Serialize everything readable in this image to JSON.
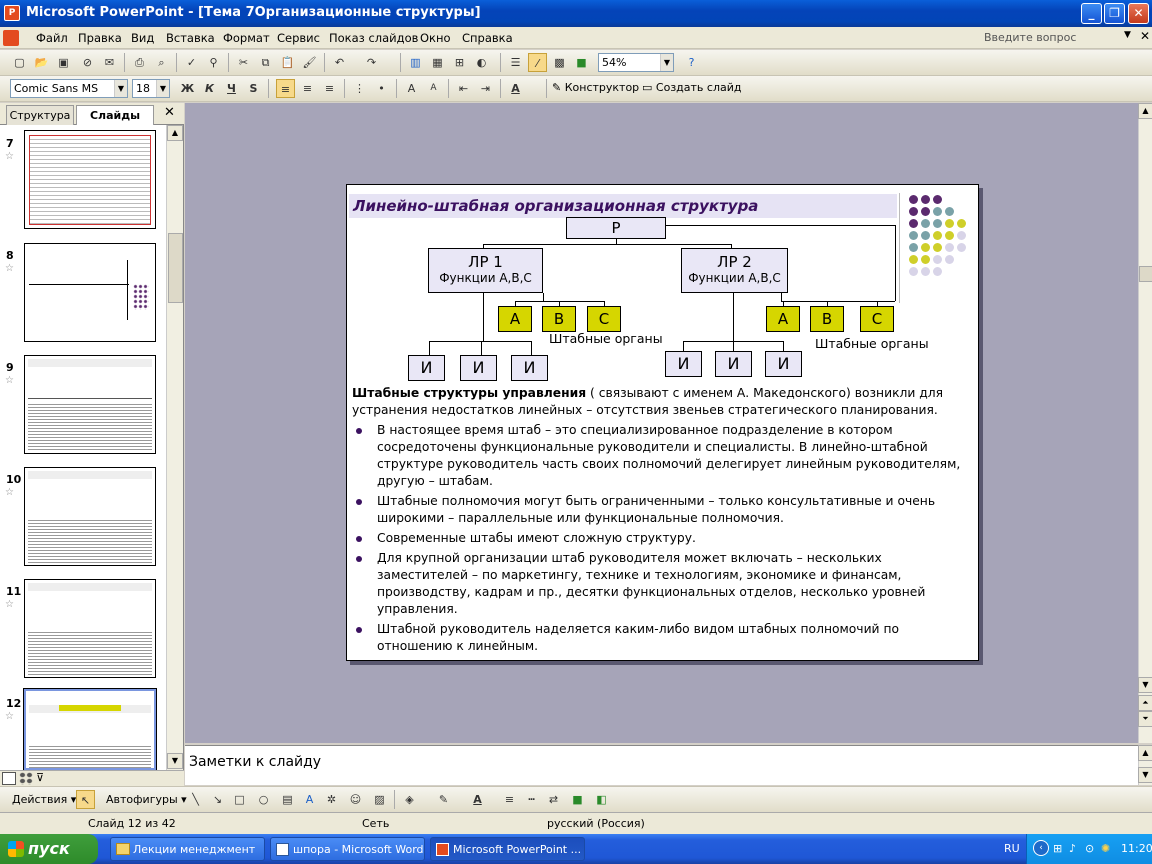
{
  "window": {
    "title": "Microsoft PowerPoint - [Тема 7Организационные структуры]",
    "icon_label": "P",
    "min": "_",
    "max": "❐",
    "close": "✕"
  },
  "menu": {
    "items": [
      "Файл",
      "Правка",
      "Вид",
      "Вставка",
      "Формат",
      "Сервис",
      "Показ слайдов",
      "Окно",
      "Справка"
    ],
    "help_placeholder": "Введите вопрос"
  },
  "standard_toolbar": {
    "zoom": "54%"
  },
  "format_toolbar": {
    "font": "Comic Sans MS",
    "size": "18",
    "bold": "Ж",
    "italic": "К",
    "underline": "Ч",
    "shadow": "S",
    "designer": "Конструктор",
    "new_slide": "Создать слайд"
  },
  "left_pane": {
    "tabs": [
      "Структура",
      "Слайды"
    ],
    "slide_numbers": [
      "7",
      "8",
      "9",
      "10",
      "11",
      "12"
    ],
    "star": "☆"
  },
  "slide": {
    "title": "Линейно-штабная организационная структура",
    "root": "Р",
    "lr1": {
      "name": "ЛР 1",
      "func": "Функции А,В,С"
    },
    "lr2": {
      "name": "ЛР 2",
      "func": "Функции А,В,С"
    },
    "staff_boxes": [
      "А",
      "В",
      "С"
    ],
    "staff_label": "Штабные органы",
    "exec": "И",
    "intro_bold": "Штабные структуры управления",
    "intro_rest": " ( связывают с именем А. Македонского)  возникли для устранения недостатков линейных – отсутствия звеньев стратегического планирования.",
    "bullets": [
      "В настоящее время штаб – это специализированное подразделение в котором сосредоточены функциональные руководители и специалисты. В линейно-штабной структуре руководитель часть своих полномочий делегирует линейным руководителям, другую – штабам.",
      "Штабные полномочия могут быть ограниченными – только консультативные и очень широкими – параллельные или функциональные  полномочия.",
      "Современные штабы имеют сложную структуру.",
      "Для крупной организации  штаб руководителя может включать – нескольких заместителей – по маркетингу, технике и технологиям, экономике и финансам, производству, кадрам и пр., десятки функциональных отделов, несколько уровней управления.",
      "Штабной руководитель наделяется каким-либо видом штабных полномочий по отношению к линейным."
    ],
    "colors": {
      "title_text": "#3b1160",
      "yellow": "#d6d600",
      "dot_purple": "#5b2a6e",
      "dot_teal": "#7aa2a8",
      "dot_yellow": "#cfcf2a",
      "dot_lilac": "#d8d4e8"
    }
  },
  "notes": {
    "placeholder": "Заметки к слайду"
  },
  "drawing_toolbar": {
    "actions": "Действия",
    "autoshapes": "Автофигуры"
  },
  "status": {
    "slide": "Слайд 12 из 42",
    "design": "Сеть",
    "language": "русский (Россия)"
  },
  "taskbar": {
    "start": "пуск",
    "tasks": [
      "Лекции менеджмент",
      "шпора - Microsoft Word",
      "Microsoft PowerPoint ..."
    ],
    "lang": "RU",
    "time": "11:20"
  }
}
